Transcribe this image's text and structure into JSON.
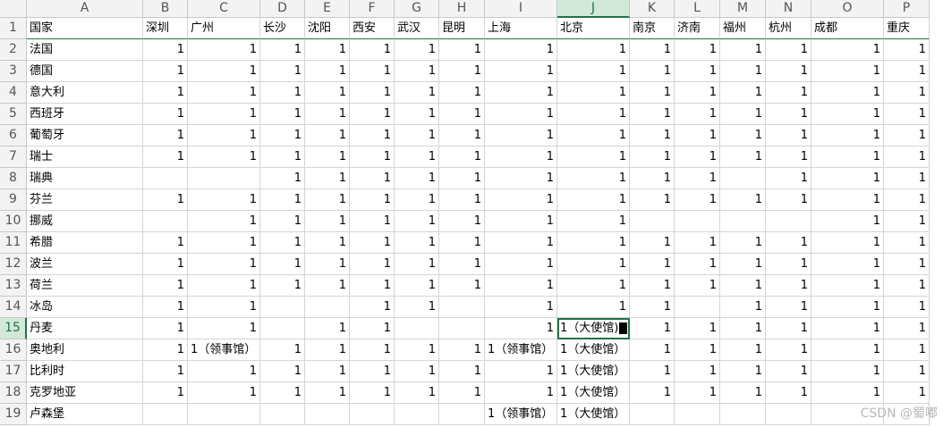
{
  "columns": [
    "A",
    "B",
    "C",
    "D",
    "E",
    "F",
    "G",
    "H",
    "I",
    "J",
    "K",
    "L",
    "M",
    "N",
    "O",
    "P"
  ],
  "active_column": "J",
  "active_row": 15,
  "header": {
    "row_number": "1",
    "cells": [
      "国家",
      "深圳",
      "广州",
      "长沙",
      "沈阳",
      "西安",
      "武汉",
      "昆明",
      "上海",
      "北京",
      "南京",
      "济南",
      "福州",
      "杭州",
      "成都",
      "重庆"
    ]
  },
  "rows": [
    {
      "n": "2",
      "cells": [
        "法国",
        "1",
        "1",
        "1",
        "1",
        "1",
        "1",
        "1",
        "1",
        "1",
        "1",
        "1",
        "1",
        "1",
        "1",
        "1"
      ]
    },
    {
      "n": "3",
      "cells": [
        "德国",
        "1",
        "1",
        "1",
        "1",
        "1",
        "1",
        "1",
        "1",
        "1",
        "1",
        "1",
        "1",
        "1",
        "1",
        "1"
      ]
    },
    {
      "n": "4",
      "cells": [
        "意大利",
        "1",
        "1",
        "1",
        "1",
        "1",
        "1",
        "1",
        "1",
        "1",
        "1",
        "1",
        "1",
        "1",
        "1",
        "1"
      ]
    },
    {
      "n": "5",
      "cells": [
        "西班牙",
        "1",
        "1",
        "1",
        "1",
        "1",
        "1",
        "1",
        "1",
        "1",
        "1",
        "1",
        "1",
        "1",
        "1",
        "1"
      ]
    },
    {
      "n": "6",
      "cells": [
        "葡萄牙",
        "1",
        "1",
        "1",
        "1",
        "1",
        "1",
        "1",
        "1",
        "1",
        "1",
        "1",
        "1",
        "1",
        "1",
        "1"
      ]
    },
    {
      "n": "7",
      "cells": [
        "瑞士",
        "1",
        "1",
        "1",
        "1",
        "1",
        "1",
        "1",
        "1",
        "1",
        "1",
        "1",
        "1",
        "1",
        "1",
        "1"
      ]
    },
    {
      "n": "8",
      "cells": [
        "瑞典",
        "",
        "",
        "1",
        "1",
        "1",
        "1",
        "1",
        "1",
        "1",
        "1",
        "1",
        "",
        "1",
        "1",
        "1"
      ]
    },
    {
      "n": "9",
      "cells": [
        "芬兰",
        "1",
        "1",
        "1",
        "1",
        "1",
        "1",
        "1",
        "1",
        "1",
        "1",
        "1",
        "1",
        "1",
        "1",
        "1"
      ]
    },
    {
      "n": "10",
      "cells": [
        "挪威",
        "",
        "1",
        "1",
        "1",
        "1",
        "1",
        "1",
        "1",
        "1",
        "",
        "",
        "",
        "",
        "1",
        "1"
      ]
    },
    {
      "n": "11",
      "cells": [
        "希腊",
        "1",
        "1",
        "1",
        "1",
        "1",
        "1",
        "1",
        "1",
        "1",
        "1",
        "1",
        "1",
        "1",
        "1",
        "1"
      ]
    },
    {
      "n": "12",
      "cells": [
        "波兰",
        "1",
        "1",
        "1",
        "1",
        "1",
        "1",
        "1",
        "1",
        "1",
        "1",
        "1",
        "1",
        "1",
        "1",
        "1"
      ]
    },
    {
      "n": "13",
      "cells": [
        "荷兰",
        "1",
        "1",
        "1",
        "1",
        "1",
        "1",
        "1",
        "1",
        "1",
        "1",
        "1",
        "1",
        "1",
        "1",
        "1"
      ]
    },
    {
      "n": "14",
      "cells": [
        "冰岛",
        "1",
        "1",
        "",
        "",
        "1",
        "1",
        "",
        "1",
        "1",
        "1",
        "",
        "1",
        "1",
        "1",
        "1"
      ]
    },
    {
      "n": "15",
      "cells": [
        "丹麦",
        "1",
        "1",
        "",
        "1",
        "1",
        "",
        "",
        "1",
        "1（大使馆)",
        "1",
        "1",
        "1",
        "1",
        "1",
        "1"
      ]
    },
    {
      "n": "16",
      "cells": [
        "奥地利",
        "1",
        "1（领事馆）",
        "1",
        "1",
        "1",
        "1",
        "1",
        "1（领事馆）",
        "1（大使馆）",
        "1",
        "1",
        "1",
        "1",
        "1",
        "1"
      ]
    },
    {
      "n": "17",
      "cells": [
        "比利时",
        "1",
        "1",
        "1",
        "1",
        "1",
        "1",
        "1",
        "1",
        "1（大使馆）",
        "1",
        "1",
        "1",
        "1",
        "1",
        "1"
      ]
    },
    {
      "n": "18",
      "cells": [
        "克罗地亚",
        "1",
        "1",
        "1",
        "1",
        "1",
        "1",
        "1",
        "1",
        "1（大使馆）",
        "1",
        "1",
        "1",
        "1",
        "1",
        "1"
      ]
    },
    {
      "n": "19",
      "cells": [
        "卢森堡",
        "",
        "",
        "",
        "",
        "",
        "",
        "",
        "1（领事馆）",
        "1（大使馆）",
        "",
        "",
        "",
        "",
        "",
        ""
      ]
    }
  ],
  "watermark": "CSDN @蜀嘟"
}
